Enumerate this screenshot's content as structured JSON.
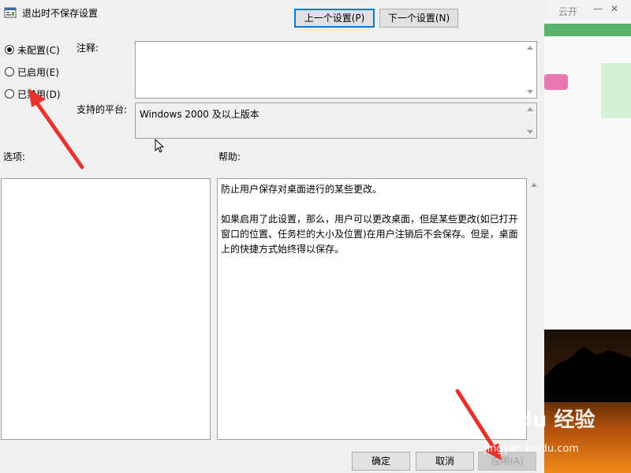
{
  "window": {
    "title": "退出时不保存设置",
    "icon": "policy-icon"
  },
  "nav": {
    "prev_label": "上一个设置(P)",
    "next_label": "下一个设置(N)"
  },
  "state": {
    "options": [
      {
        "label": "未配置(C)",
        "checked": true
      },
      {
        "label": "已启用(E)",
        "checked": false
      },
      {
        "label": "已禁用(D)",
        "checked": false
      }
    ]
  },
  "comment": {
    "label": "注释:",
    "value": ""
  },
  "platform": {
    "label": "支持的平台:",
    "value": "Windows 2000 及以上版本"
  },
  "options_section": {
    "label": "选项:"
  },
  "help_section": {
    "label": "帮助:",
    "text": "防止用户保存对桌面进行的某些更改。\n\n如果启用了此设置，那么，用户可以更改桌面，但是某些更改(如已打开窗口的位置、任务栏的大小及位置)在用户注销后不会保存。但是，桌面上的快捷方式始终得以保存。"
  },
  "footer": {
    "ok_label": "确定",
    "cancel_label": "取消",
    "apply_label": "应用(A)"
  },
  "background": {
    "tab_text": "云开",
    "watermark": "Baidu 经验",
    "watermark_url": "jingyan.baidu.com"
  },
  "colors": {
    "accent": "#0078d7",
    "arrow": "#e8322c"
  }
}
